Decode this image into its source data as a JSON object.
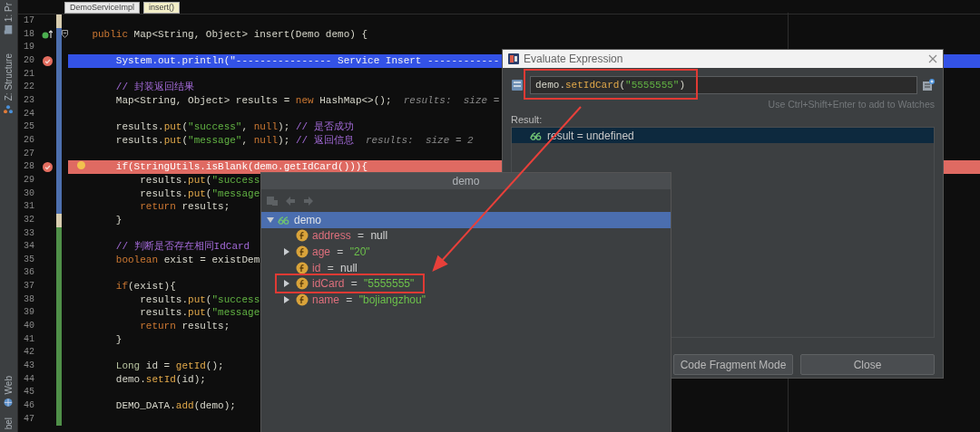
{
  "tool_strip": {
    "top": [
      {
        "label": "1: Pr",
        "kind": "project"
      },
      {
        "label": "Z: Structure",
        "kind": "structure"
      }
    ],
    "bottom": [
      {
        "label": "Web",
        "kind": "web"
      },
      {
        "label": "bel",
        "kind": "other"
      }
    ]
  },
  "breadcrumbs": [
    {
      "label": "DemoServiceImpl",
      "selected": false
    },
    {
      "label": "insert()",
      "selected": true
    }
  ],
  "editor": {
    "lines": [
      {
        "number": "17",
        "kind": "moved",
        "breakpoint": false,
        "override": false,
        "executing": false,
        "fold": false,
        "bulb": false
      },
      {
        "number": "18",
        "kind": "modified",
        "breakpoint": false,
        "override": true,
        "executing": false,
        "fold": true,
        "bulb": false,
        "tokens": [
          {
            "kind": "keyword",
            "text": "    public"
          },
          {
            "kind": "plain",
            "text": " Map<String, Object> insert(Demo demo) {"
          }
        ]
      },
      {
        "number": "19",
        "kind": "modified",
        "breakpoint": false,
        "override": false,
        "executing": false,
        "fold": false,
        "bulb": false
      },
      {
        "number": "20",
        "kind": "modified",
        "breakpoint": true,
        "override": false,
        "executing": true,
        "fold": false,
        "bulb": false,
        "tokens": [
          {
            "kind": "plain",
            "text": "        System.out.println("
          },
          {
            "kind": "string",
            "text": "\"---------------- Service Insert ------------"
          }
        ]
      },
      {
        "number": "21",
        "kind": "modified",
        "breakpoint": false,
        "override": false,
        "executing": false,
        "fold": false,
        "bulb": false
      },
      {
        "number": "22",
        "kind": "modified",
        "breakpoint": false,
        "override": false,
        "executing": false,
        "fold": false,
        "bulb": false,
        "tokens": [
          {
            "kind": "comment",
            "text": "        // 封装返回结果"
          }
        ]
      },
      {
        "number": "23",
        "kind": "modified",
        "breakpoint": false,
        "override": false,
        "executing": false,
        "fold": false,
        "bulb": false,
        "tokens": [
          {
            "kind": "plain",
            "text": "        Map<String, Object> results = "
          },
          {
            "kind": "keyword",
            "text": "new"
          },
          {
            "kind": "plain",
            "text": " HashMap<>();"
          },
          {
            "kind": "hint",
            "text": "  results:  size ="
          }
        ]
      },
      {
        "number": "24",
        "kind": "modified",
        "breakpoint": false,
        "override": false,
        "executing": false,
        "fold": false,
        "bulb": false
      },
      {
        "number": "25",
        "kind": "modified",
        "breakpoint": false,
        "override": false,
        "executing": false,
        "fold": false,
        "bulb": false,
        "tokens": [
          {
            "kind": "plain",
            "text": "        results."
          },
          {
            "kind": "method",
            "text": "put"
          },
          {
            "kind": "plain",
            "text": "("
          },
          {
            "kind": "string",
            "text": "\"success\""
          },
          {
            "kind": "plain",
            "text": ", "
          },
          {
            "kind": "keyword",
            "text": "null"
          },
          {
            "kind": "plain",
            "text": "); "
          },
          {
            "kind": "comment",
            "text": "// 是否成功"
          }
        ]
      },
      {
        "number": "26",
        "kind": "modified",
        "breakpoint": false,
        "override": false,
        "executing": false,
        "fold": false,
        "bulb": false,
        "tokens": [
          {
            "kind": "plain",
            "text": "        results."
          },
          {
            "kind": "method",
            "text": "put"
          },
          {
            "kind": "plain",
            "text": "("
          },
          {
            "kind": "string",
            "text": "\"message\""
          },
          {
            "kind": "plain",
            "text": ", "
          },
          {
            "kind": "keyword",
            "text": "null"
          },
          {
            "kind": "plain",
            "text": "); "
          },
          {
            "kind": "comment",
            "text": "// 返回信息"
          },
          {
            "kind": "hint",
            "text": "  results:  size = 2"
          }
        ]
      },
      {
        "number": "27",
        "kind": "modified",
        "breakpoint": false,
        "override": false,
        "executing": false,
        "fold": false,
        "bulb": false
      },
      {
        "number": "28",
        "kind": "modified",
        "breakpoint": true,
        "override": false,
        "executing": false,
        "fold": false,
        "bulb": true,
        "tokens": [
          {
            "kind": "plain",
            "text": "        if(StringUtils.isBlank(demo.getIdCard())){"
          }
        ]
      },
      {
        "number": "29",
        "kind": "modified",
        "breakpoint": false,
        "override": false,
        "executing": false,
        "fold": false,
        "bulb": false,
        "tokens": [
          {
            "kind": "plain",
            "text": "            results."
          },
          {
            "kind": "method",
            "text": "put"
          },
          {
            "kind": "plain",
            "text": "("
          },
          {
            "kind": "string",
            "text": "\"success"
          }
        ]
      },
      {
        "number": "30",
        "kind": "modified",
        "breakpoint": false,
        "override": false,
        "executing": false,
        "fold": false,
        "bulb": false,
        "tokens": [
          {
            "kind": "plain",
            "text": "            results."
          },
          {
            "kind": "method",
            "text": "put"
          },
          {
            "kind": "plain",
            "text": "("
          },
          {
            "kind": "string",
            "text": "\"message"
          }
        ]
      },
      {
        "number": "31",
        "kind": "modified",
        "breakpoint": false,
        "override": false,
        "executing": false,
        "fold": false,
        "bulb": false,
        "tokens": [
          {
            "kind": "keyword",
            "text": "            return"
          },
          {
            "kind": "plain",
            "text": " results;"
          }
        ]
      },
      {
        "number": "32",
        "kind": "moved",
        "breakpoint": false,
        "override": false,
        "executing": false,
        "fold": false,
        "bulb": false,
        "tokens": [
          {
            "kind": "plain",
            "text": "        }"
          }
        ]
      },
      {
        "number": "33",
        "kind": "added",
        "breakpoint": false,
        "override": false,
        "executing": false,
        "fold": false,
        "bulb": false
      },
      {
        "number": "34",
        "kind": "added",
        "breakpoint": false,
        "override": false,
        "executing": false,
        "fold": false,
        "bulb": false,
        "tokens": [
          {
            "kind": "comment",
            "text": "        // 判断是否存在相同IdCard"
          }
        ]
      },
      {
        "number": "35",
        "kind": "added",
        "breakpoint": false,
        "override": false,
        "executing": false,
        "fold": false,
        "bulb": false,
        "tokens": [
          {
            "kind": "keyword",
            "text": "        boolean"
          },
          {
            "kind": "plain",
            "text": " exist = existDem"
          }
        ]
      },
      {
        "number": "36",
        "kind": "added",
        "breakpoint": false,
        "override": false,
        "executing": false,
        "fold": false,
        "bulb": false
      },
      {
        "number": "37",
        "kind": "added",
        "breakpoint": false,
        "override": false,
        "executing": false,
        "fold": false,
        "bulb": false,
        "tokens": [
          {
            "kind": "keyword",
            "text": "        if"
          },
          {
            "kind": "plain",
            "text": "(exist){"
          }
        ]
      },
      {
        "number": "38",
        "kind": "added",
        "breakpoint": false,
        "override": false,
        "executing": false,
        "fold": false,
        "bulb": false,
        "tokens": [
          {
            "kind": "plain",
            "text": "            results."
          },
          {
            "kind": "method",
            "text": "put"
          },
          {
            "kind": "plain",
            "text": "("
          },
          {
            "kind": "string",
            "text": "\"success"
          }
        ]
      },
      {
        "number": "39",
        "kind": "added",
        "breakpoint": false,
        "override": false,
        "executing": false,
        "fold": false,
        "bulb": false,
        "tokens": [
          {
            "kind": "plain",
            "text": "            results."
          },
          {
            "kind": "method",
            "text": "put"
          },
          {
            "kind": "plain",
            "text": "("
          },
          {
            "kind": "string",
            "text": "\"message"
          }
        ]
      },
      {
        "number": "40",
        "kind": "added",
        "breakpoint": false,
        "override": false,
        "executing": false,
        "fold": false,
        "bulb": false,
        "tokens": [
          {
            "kind": "keyword",
            "text": "            return"
          },
          {
            "kind": "plain",
            "text": " results;"
          }
        ]
      },
      {
        "number": "41",
        "kind": "added",
        "breakpoint": false,
        "override": false,
        "executing": false,
        "fold": false,
        "bulb": false,
        "tokens": [
          {
            "kind": "plain",
            "text": "        }"
          }
        ]
      },
      {
        "number": "42",
        "kind": "added",
        "breakpoint": false,
        "override": false,
        "executing": false,
        "fold": false,
        "bulb": false
      },
      {
        "number": "43",
        "kind": "added",
        "breakpoint": false,
        "override": false,
        "executing": false,
        "fold": false,
        "bulb": false,
        "tokens": [
          {
            "kind": "type",
            "text": "        Long"
          },
          {
            "kind": "plain",
            "text": " id = "
          },
          {
            "kind": "method",
            "text": "getId"
          },
          {
            "kind": "plain",
            "text": "();"
          }
        ]
      },
      {
        "number": "44",
        "kind": "added",
        "breakpoint": false,
        "override": false,
        "executing": false,
        "fold": false,
        "bulb": false,
        "tokens": [
          {
            "kind": "plain",
            "text": "        demo."
          },
          {
            "kind": "method",
            "text": "setId"
          },
          {
            "kind": "plain",
            "text": "(id);"
          }
        ]
      },
      {
        "number": "45",
        "kind": "added",
        "breakpoint": false,
        "override": false,
        "executing": false,
        "fold": false,
        "bulb": false
      },
      {
        "number": "46",
        "kind": "added",
        "breakpoint": false,
        "override": false,
        "executing": false,
        "fold": false,
        "bulb": false,
        "tokens": [
          {
            "kind": "plain",
            "text": "        DEMO_DATA."
          },
          {
            "kind": "method",
            "text": "add"
          },
          {
            "kind": "plain",
            "text": "(demo);"
          }
        ]
      },
      {
        "number": "47",
        "kind": "added",
        "breakpoint": false,
        "override": false,
        "executing": false,
        "fold": false,
        "bulb": false
      }
    ]
  },
  "evaluate_dialog": {
    "title": "Evaluate Expression",
    "expression": {
      "annotated": true,
      "tokens": [
        {
          "kind": "plain",
          "text": "demo."
        },
        {
          "kind": "method",
          "text": "setIdCard"
        },
        {
          "kind": "plain",
          "text": "("
        },
        {
          "kind": "string",
          "text": "\"5555555\""
        },
        {
          "kind": "plain",
          "text": ")"
        }
      ]
    },
    "hint": "Use Ctrl+Shift+Enter to add to Watches",
    "result_label": "Result:",
    "result": {
      "text": "result = undefined",
      "selected": true
    },
    "buttons": [
      {
        "label": "Code Fragment Mode",
        "kind": "mode"
      },
      {
        "label": "Close",
        "kind": "close"
      }
    ]
  },
  "variables_popup": {
    "title": "demo",
    "toolbar": [
      {
        "kind": "pin",
        "disabled": true
      },
      {
        "kind": "back",
        "disabled": true
      },
      {
        "kind": "forward",
        "disabled": true
      }
    ],
    "tree": {
      "name": "demo",
      "expandable": true,
      "expanded": true,
      "selected": true,
      "children": [
        {
          "name": "address",
          "operator": "=",
          "value": "null",
          "kind": "null",
          "expandable": false,
          "selected": false,
          "annotated": false
        },
        {
          "name": "age",
          "operator": "=",
          "value": "\"20\"",
          "kind": "string",
          "expandable": true,
          "expanded": false,
          "selected": false,
          "annotated": false
        },
        {
          "name": "id",
          "operator": "=",
          "value": "null",
          "kind": "null",
          "expandable": false,
          "selected": false,
          "annotated": false
        },
        {
          "name": "idCard",
          "operator": "=",
          "value": "\"5555555\"",
          "kind": "string",
          "expandable": true,
          "expanded": false,
          "selected": false,
          "annotated": true
        },
        {
          "name": "name",
          "operator": "=",
          "value": "\"bojiangzhou\"",
          "kind": "string",
          "expandable": true,
          "expanded": false,
          "selected": false,
          "annotated": false
        }
      ]
    }
  },
  "annotation_arrow": {
    "visible": true
  }
}
